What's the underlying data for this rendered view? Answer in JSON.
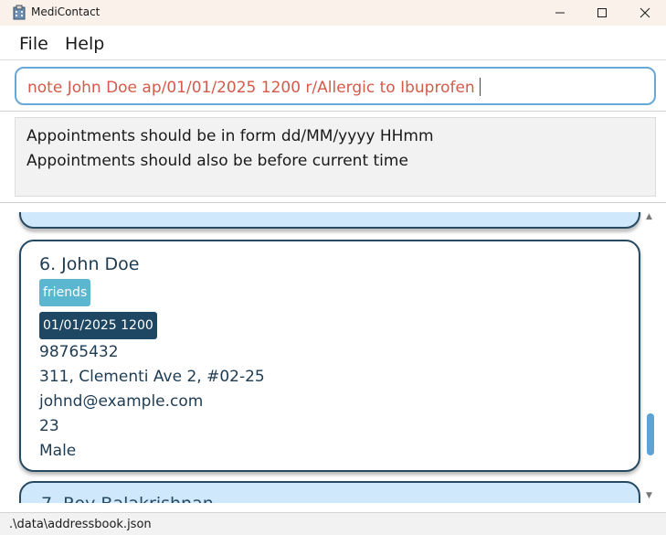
{
  "window": {
    "title": "MediContact"
  },
  "menu": {
    "file": "File",
    "help": "Help"
  },
  "command": {
    "value": "note John Doe ap/01/01/2025 1200 r/Allergic to Ibuprofen"
  },
  "result": {
    "line1": "Appointments should be in form dd/MM/yyyy HHmm",
    "line2": "Appointments should also be before current time"
  },
  "contacts": {
    "current": {
      "name": "6. John Doe",
      "tag": "friends",
      "appointment": "01/01/2025 1200",
      "phone": "98765432",
      "address": "311, Clementi Ave 2, #02-25",
      "email": "johnd@example.com",
      "age": "23",
      "gender": "Male"
    },
    "next_name_partial": "7. Roy Balakrishnan"
  },
  "status": {
    "path": ".\\data\\addressbook.json"
  },
  "colors": {
    "accent": "#66a9d8",
    "command_text": "#d45a4a",
    "tag_friends": "#5bb6cf",
    "tag_appointment": "#1d4763",
    "card_border": "#274a63"
  }
}
